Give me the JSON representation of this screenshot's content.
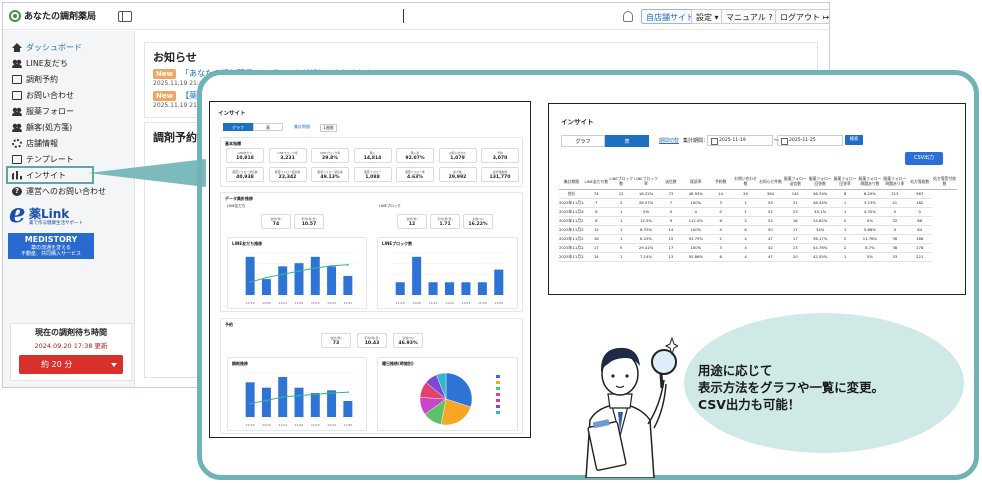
{
  "app": {
    "logo_text": "あなたの調剤薬局",
    "header": {
      "store_site": "自店舗サイト",
      "settings": "設定",
      "manual": "マニュアル",
      "logout": "ログアウト"
    },
    "sidebar": {
      "items": [
        {
          "label": "ダッシュボード",
          "icon": "house-icon"
        },
        {
          "label": "LINE友だち",
          "icon": "people-icon"
        },
        {
          "label": "調剤予約",
          "icon": "calendar-icon"
        },
        {
          "label": "お問い合わせ",
          "icon": "mail-icon"
        },
        {
          "label": "服薬フォロー",
          "icon": "followup-icon"
        },
        {
          "label": "顧客(処方箋)",
          "icon": "customer-icon"
        },
        {
          "label": "店舗情報",
          "icon": "gear-icon"
        },
        {
          "label": "テンプレート",
          "icon": "document-icon"
        },
        {
          "label": "インサイト",
          "icon": "bar-chart-icon"
        },
        {
          "label": "運営へのお問い合わせ",
          "icon": "question-icon"
        }
      ],
      "ekusuri": {
        "mark": "e",
        "title": "薬Link",
        "subtitle": "薬で作る健康生活サポート"
      },
      "medistory": {
        "title": "MEDISTORY",
        "line1": "薬の流通を変える",
        "line2": "不動産、共同購入サービス"
      },
      "wait": {
        "title": "現在の調剤待ち時間",
        "updated": "2024.09.20 17:38 更新",
        "value": "約 20 分"
      }
    },
    "notice": {
      "title": "お知らせ",
      "items": [
        {
          "badge": "New",
          "text": "「あなたの調剤薬局」ロゴマークが新しくなりました",
          "date": "2025.11.19 21:45"
        },
        {
          "badge": "New",
          "text": "【薬局",
          "date": "2025.11.19 21:30"
        }
      ]
    },
    "rx_title": "調剤予約"
  },
  "insight_graph": {
    "title": "インサイト",
    "tabs": [
      "グラフ",
      "表"
    ],
    "controls": {
      "period_label": "集計期間",
      "period_value": "1週間"
    },
    "basic_title": "基本指標",
    "kpis": [
      {
        "label": "LINE友だち",
        "value": "10,818",
        "delta": "-"
      },
      {
        "label": "LINEブロック率",
        "value": "3,231",
        "delta": "-"
      },
      {
        "label": "LINEブロック率",
        "value": "29.8%",
        "delta": "-"
      },
      {
        "label": "購入",
        "value": "14,814",
        "delta": "-"
      },
      {
        "label": "購入率",
        "value": "92.07%",
        "delta": "-"
      },
      {
        "label": "お問い合わせ",
        "value": "1,079",
        "delta": "-"
      },
      {
        "label": "予約",
        "value": "3,070",
        "delta": "-"
      },
      {
        "label": "服薬フォロー送信数",
        "value": "40,938",
        "delta": "-"
      },
      {
        "label": "服薬フォロー返信数",
        "value": "22,342",
        "delta": "-"
      },
      {
        "label": "服薬フォロー返信率",
        "value": "49.13%",
        "delta": "-"
      },
      {
        "label": "服薬フォロー",
        "value": "1,088",
        "delta": "-"
      },
      {
        "label": "服薬フォロー率",
        "value": "4.63%",
        "delta": "-"
      },
      {
        "label": "処方箋",
        "value": "29,992",
        "delta": "-"
      },
      {
        "label": "処方箋枚数",
        "value": "131,770",
        "delta": "-"
      }
    ],
    "line_title": "データ集計推移",
    "friends_section": "LINE友だち",
    "block_section": "LINEブロック",
    "friends_kpis": [
      {
        "label": "合計(件)",
        "value": "74"
      },
      {
        "label": "平均(件/日)",
        "value": "10.57"
      }
    ],
    "block_kpis": [
      {
        "label": "合計(件)",
        "value": "12"
      },
      {
        "label": "平均(件/日)",
        "value": "1.71"
      },
      {
        "label": "割合(%)",
        "value": "16.22%"
      }
    ],
    "rx_section": "予約",
    "rx_kpis": [
      {
        "label": "合計(件)",
        "value": "73"
      },
      {
        "label": "平均(件/日)",
        "value": "10.43"
      },
      {
        "label": "割合(%)",
        "value": "46.93%"
      }
    ],
    "chart_friends_title": "LINE友だち推移",
    "chart_block_title": "LINEブロック数",
    "chart_rx_title": "調剤推移",
    "chart_pie_title": "曜日推移(時間別)"
  },
  "chart_data": [
    {
      "type": "bar",
      "title": "LINE友だち推移",
      "categories": [
        "11/19",
        "11/20",
        "11/21",
        "11/22",
        "11/23",
        "11/24",
        "11/25"
      ],
      "values": [
        12,
        5,
        9,
        10,
        12,
        9,
        6
      ],
      "line": [
        4,
        5.5,
        6.5,
        7.5,
        8.5,
        9.2,
        9.5
      ]
    },
    {
      "type": "bar",
      "title": "LINEブロック数",
      "categories": [
        "11/19",
        "11/20",
        "11/21",
        "11/22",
        "11/23",
        "11/24",
        "11/25"
      ],
      "values": [
        1,
        3,
        1,
        1,
        1,
        1,
        2
      ]
    },
    {
      "type": "bar",
      "title": "調剤推移",
      "categories": [
        "11/19",
        "11/20",
        "11/21",
        "11/22",
        "11/23",
        "11/24",
        "11/25"
      ],
      "values": [
        13,
        11,
        15,
        11,
        9,
        10,
        6
      ],
      "line": [
        5,
        6.2,
        7.5,
        8,
        8.5,
        9,
        9.3
      ]
    },
    {
      "type": "pie",
      "title": "曜日推移(時間別)",
      "values": [
        30,
        23,
        12,
        11,
        10,
        8,
        6
      ],
      "colors": [
        "#2e73d6",
        "#f5a623",
        "#5ec26a",
        "#c846c8",
        "#e0436b",
        "#7b49d6",
        "#38b6c9"
      ]
    }
  ],
  "insight_table": {
    "title": "インサイト",
    "tabs": [
      "グラフ",
      "表"
    ],
    "controls": {
      "range_label": "期間切替",
      "period_label": "集計期間：",
      "from": "2025-11-19",
      "to": "2025-11-25",
      "search": "検索"
    },
    "csv_button": "CSV出力",
    "headers": [
      "集計期間",
      "LINE友だち数",
      "LINEブロック数",
      "LINEブロック率",
      "送信数",
      "既読率",
      "予約数",
      "お問い合わせ数",
      "お知らせ件数",
      "服薬フォロー送信数",
      "服薬フォロー回答数",
      "服薬フォロー回答率",
      "服薬フォロー問題あり数",
      "服薬フォロー問題あり率",
      "処方箋枚数",
      "処方箋受付枚数"
    ],
    "rows": [
      [
        "合計",
        "74",
        "12",
        "16.22%",
        "73",
        "46.93%",
        "14",
        "29",
        "364",
        "141",
        "46.39%",
        "8",
        "6.29%",
        "213",
        "967"
      ],
      [
        "2025年11月19日",
        "7",
        "2",
        "28.57%",
        "7",
        "100%",
        "3",
        "1",
        "54",
        "31",
        "48.44%",
        "1",
        "3.23%",
        "41",
        "182"
      ],
      [
        "2025年11月20日",
        "6",
        "1",
        "0%",
        "0",
        "0",
        "0",
        "1",
        "51",
        "23",
        "45.1%",
        "1",
        "4.35%",
        "0",
        "0"
      ],
      [
        "2025年11月21日",
        "8",
        "1",
        "12.5%",
        "9",
        "112.5%",
        "6",
        "2",
        "52",
        "18",
        "34.62%",
        "0",
        "0%",
        "32",
        "86"
      ],
      [
        "2025年11月22日",
        "12",
        "1",
        "8.33%",
        "14",
        "100%",
        "4",
        "6",
        "50",
        "17",
        "34%",
        "1",
        "5.88%",
        "0",
        "84"
      ],
      [
        "2025年11月23日",
        "16",
        "1",
        "6.25%",
        "15",
        "93.75%",
        "2",
        "4",
        "47",
        "17",
        "36.17%",
        "2",
        "11.76%",
        "36",
        "166"
      ],
      [
        "2025年11月24日",
        "17",
        "5",
        "29.41%",
        "17",
        "100%",
        "3",
        "4",
        "42",
        "23",
        "54.76%",
        "2",
        "8.7%",
        "38",
        "178"
      ],
      [
        "2025年11月25日",
        "14",
        "1",
        "7.14%",
        "13",
        "92.86%",
        "6",
        "4",
        "47",
        "20",
        "42.55%",
        "1",
        "5%",
        "33",
        "221"
      ]
    ]
  },
  "caption": {
    "line1": "用途に応じて",
    "line2": "表示方法をグラフや一覧に変更。",
    "line3": "CSV出力も可能！"
  },
  "colors": {
    "accent": "#1f6fc7",
    "frame": "#6fb3b6",
    "bubble": "#cfe9e6",
    "bar": "#2e73d6",
    "line": "#3bb39a"
  }
}
